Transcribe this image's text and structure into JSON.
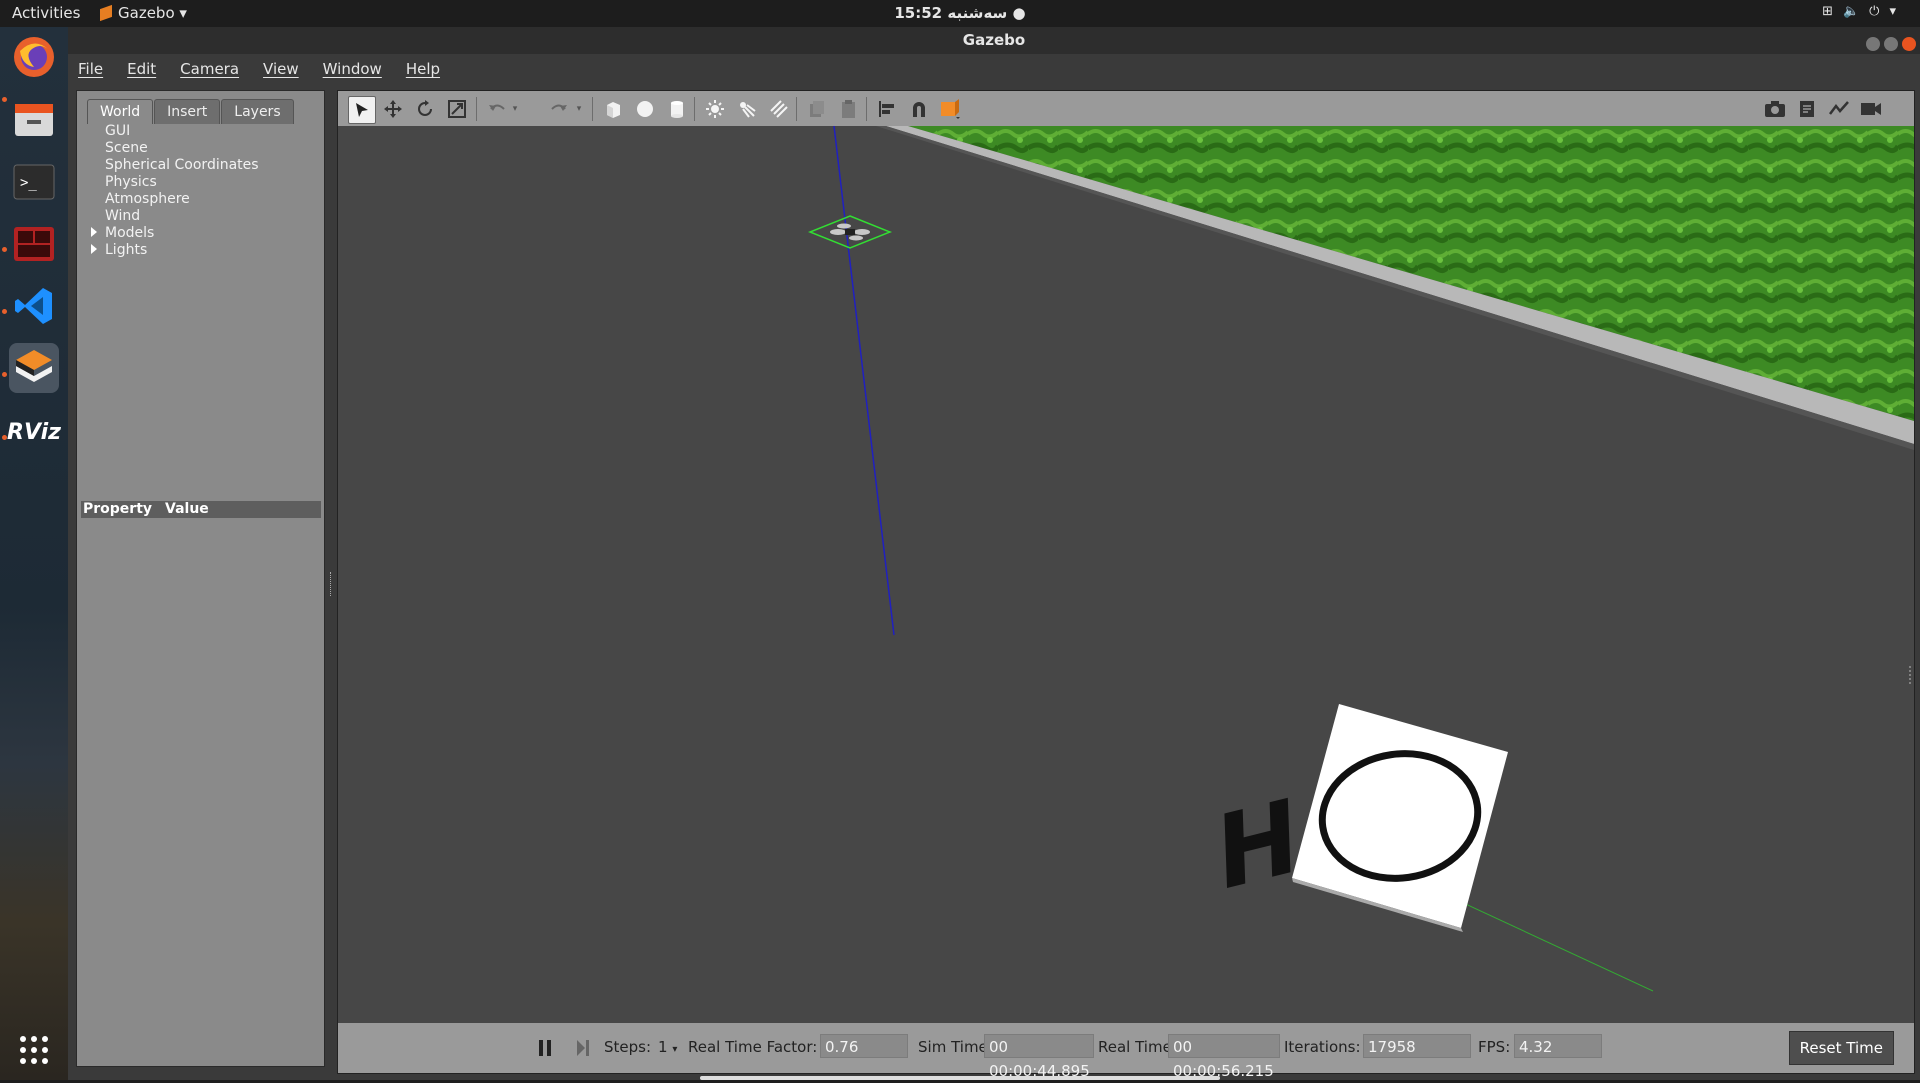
{
  "topbar": {
    "activities": "Activities",
    "app_name": "Gazebo",
    "clock": "15:52 سەشنبە ●",
    "system_icons": [
      "network-icon",
      "volume-icon",
      "power-icon",
      "chevron-down-icon"
    ]
  },
  "dock": {
    "items": [
      "firefox",
      "files",
      "terminal",
      "terminal-2",
      "vscode",
      "gazebo",
      "rviz"
    ],
    "rviz_label": "RViz",
    "show_apps_icon": "grid-icon"
  },
  "window": {
    "title": "Gazebo"
  },
  "menu": {
    "file": "File",
    "edit": "Edit",
    "camera": "Camera",
    "view": "View",
    "window": "Window",
    "help": "Help"
  },
  "left_panel": {
    "tabs": [
      "World",
      "Insert",
      "Layers"
    ],
    "active_tab": "World",
    "tree": [
      "GUI",
      "Scene",
      "Spherical Coordinates",
      "Physics",
      "Atmosphere",
      "Wind",
      "Models",
      "Lights"
    ],
    "property_header": "Property",
    "value_header": "Value"
  },
  "toolbar": {
    "left_tools": [
      "select",
      "translate",
      "rotate",
      "scale",
      "undo",
      "redo",
      "box",
      "sphere",
      "cylinder",
      "point-light",
      "spot-light",
      "directional-light",
      "copy",
      "paste",
      "align",
      "snap",
      "view-angle"
    ],
    "right_tools": [
      "screenshot",
      "log",
      "plot",
      "record"
    ]
  },
  "bottom_bar": {
    "steps_label": "Steps:",
    "steps_value": "1",
    "rtf_label": "Real Time Factor:",
    "rtf_value": "0.76",
    "sim_time_label": "Sim Time:",
    "sim_time_value": "00 00:00:44.895",
    "real_time_label": "Real Time:",
    "real_time_value": "00 00:00:56.215",
    "iterations_label": "Iterations:",
    "iterations_value": "17958",
    "fps_label": "FPS:",
    "fps_value": "4.32",
    "reset_label": "Reset Time"
  },
  "scene": {
    "helipad_letter": "H",
    "colors": {
      "ground": "#474747",
      "grass": "#3d8a24",
      "z_axis": "#2020c0",
      "y_axis": "#33aa33"
    }
  }
}
